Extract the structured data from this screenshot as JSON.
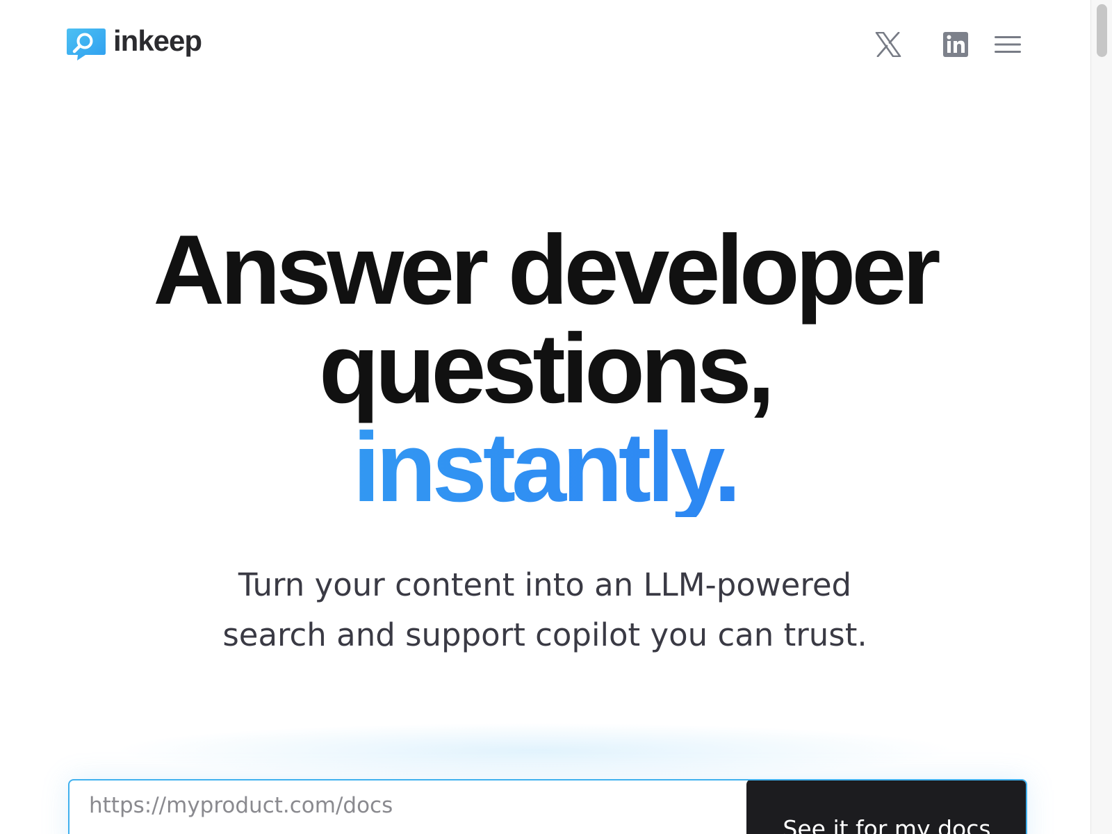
{
  "brand": {
    "name": "inkeep",
    "accent_color": "#3aa7ef",
    "logo_icon": "chat-bubble-magnifier-icon"
  },
  "header": {
    "icons": [
      "x-twitter-icon",
      "linkedin-icon",
      "hamburger-menu-icon"
    ]
  },
  "hero": {
    "title_line1": "Answer developer",
    "title_line2": "questions,",
    "title_accent": "instantly.",
    "accent_gradient": [
      "#38a8f0",
      "#2377ef"
    ],
    "subtitle_line1": "Turn your content into an LLM-powered",
    "subtitle_line2": "search and support copilot you can trust."
  },
  "cta": {
    "input_placeholder": "https://myproduct.com/docs",
    "input_value": "",
    "button_label": "See it for my docs"
  }
}
